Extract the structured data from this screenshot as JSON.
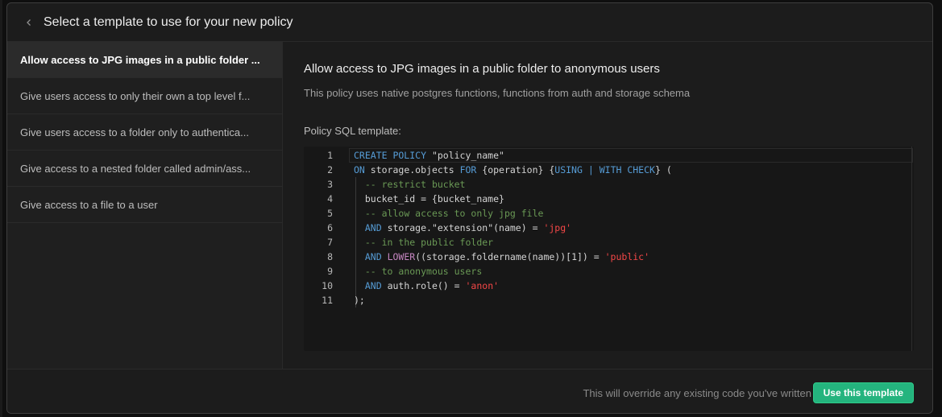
{
  "header": {
    "title": "Select a template to use for your new policy",
    "back_icon": "chevron-left-icon"
  },
  "sidebar": {
    "items": [
      {
        "label": "Allow access to JPG images in a public folder ...",
        "active": true
      },
      {
        "label": "Give users access to only their own a top level f...",
        "active": false
      },
      {
        "label": "Give users access to a folder only to authentica...",
        "active": false
      },
      {
        "label": "Give access to a nested folder called admin/ass...",
        "active": false
      },
      {
        "label": "Give access to a file to a user",
        "active": false
      }
    ]
  },
  "main": {
    "title": "Allow access to JPG images in a public folder to anonymous users",
    "description": "This policy uses native postgres functions, functions from auth and storage schema",
    "sql_label": "Policy SQL template:",
    "code_lines": [
      {
        "n": "1",
        "parts": [
          [
            "kw",
            "CREATE POLICY"
          ],
          [
            "pl",
            " \"policy_name\""
          ]
        ]
      },
      {
        "n": "2",
        "parts": [
          [
            "kw",
            "ON"
          ],
          [
            "pl",
            " storage.objects "
          ],
          [
            "kw",
            "FOR"
          ],
          [
            "pl",
            " {operation} {"
          ],
          [
            "kw",
            "USING"
          ],
          [
            "pl",
            " "
          ],
          [
            "kw",
            "|"
          ],
          [
            "pl",
            " "
          ],
          [
            "kw",
            "WITH CHECK"
          ],
          [
            "pl",
            "} ("
          ]
        ]
      },
      {
        "n": "3",
        "parts": [
          [
            "pl",
            "  "
          ],
          [
            "cm",
            "-- restrict bucket"
          ]
        ]
      },
      {
        "n": "4",
        "parts": [
          [
            "pl",
            "  bucket_id = {bucket_name}"
          ]
        ]
      },
      {
        "n": "5",
        "parts": [
          [
            "pl",
            "  "
          ],
          [
            "cm",
            "-- allow access to only jpg file"
          ]
        ]
      },
      {
        "n": "6",
        "parts": [
          [
            "pl",
            "  "
          ],
          [
            "kw",
            "AND"
          ],
          [
            "pl",
            " storage.\"extension\"(name) = "
          ],
          [
            "str",
            "'jpg'"
          ]
        ]
      },
      {
        "n": "7",
        "parts": [
          [
            "pl",
            "  "
          ],
          [
            "cm",
            "-- in the public folder"
          ]
        ]
      },
      {
        "n": "8",
        "parts": [
          [
            "pl",
            "  "
          ],
          [
            "kw",
            "AND"
          ],
          [
            "pl",
            " "
          ],
          [
            "fn",
            "LOWER"
          ],
          [
            "pl",
            "((storage.foldername(name))[1]) = "
          ],
          [
            "str",
            "'public'"
          ]
        ]
      },
      {
        "n": "9",
        "parts": [
          [
            "pl",
            "  "
          ],
          [
            "cm",
            "-- to anonymous users"
          ]
        ]
      },
      {
        "n": "10",
        "parts": [
          [
            "pl",
            "  "
          ],
          [
            "kw",
            "AND"
          ],
          [
            "pl",
            " auth.role() = "
          ],
          [
            "str",
            "'anon'"
          ]
        ]
      },
      {
        "n": "11",
        "parts": [
          [
            "pl",
            ");"
          ]
        ]
      }
    ]
  },
  "footer": {
    "note": "This will override any existing code you've written",
    "use_button_label": "Use this template"
  },
  "colors": {
    "accent": "#24b47e",
    "keyword": "#569cd6",
    "comment": "#6a9955",
    "string": "#f44747",
    "function": "#c586c0"
  }
}
